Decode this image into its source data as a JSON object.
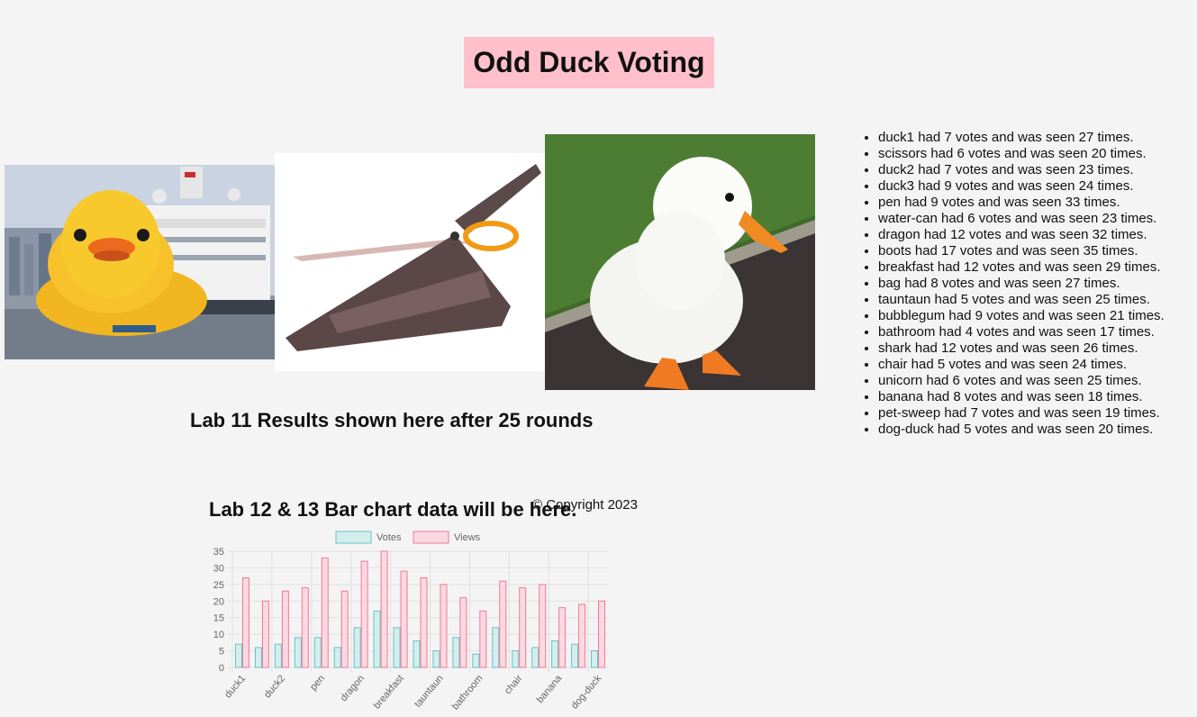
{
  "page": {
    "title": "Odd Duck Voting",
    "lab11_heading": "Lab 11 Results shown here after 25 rounds",
    "lab12_heading": "Lab 12 & 13 Bar chart data will be here.",
    "copyright": "© Copyright 2023"
  },
  "colors": {
    "title_bg": "#ffc0cb",
    "page_bg": "#f4f4f4",
    "votes_fill": "#d3eeee",
    "votes_stroke": "#6cc0c0",
    "views_fill": "#fbd9e0",
    "views_stroke": "#f07a96"
  },
  "images": [
    {
      "name": "duck1",
      "subject": "giant rubber duck next to ship"
    },
    {
      "name": "scissors",
      "subject": "pizza scissors"
    },
    {
      "name": "duck3",
      "subject": "white duck on grass"
    }
  ],
  "results": [
    "duck1 had 7 votes and was seen 27 times.",
    "scissors had 6 votes and was seen 20 times.",
    "duck2 had 7 votes and was seen 23 times.",
    "duck3 had 9 votes and was seen 24 times.",
    "pen had 9 votes and was seen 33 times.",
    "water-can had 6 votes and was seen 23 times.",
    "dragon had 12 votes and was seen 32 times.",
    "boots had 17 votes and was seen 35 times.",
    "breakfast had 12 votes and was seen 29 times.",
    "bag had 8 votes and was seen 27 times.",
    "tauntaun had 5 votes and was seen 25 times.",
    "bubblegum had 9 votes and was seen 21 times.",
    "bathroom had 4 votes and was seen 17 times.",
    "shark had 12 votes and was seen 26 times.",
    "chair had 5 votes and was seen 24 times.",
    "unicorn had 6 votes and was seen 25 times.",
    "banana had 8 votes and was seen 18 times.",
    "pet-sweep had 7 votes and was seen 19 times.",
    "dog-duck had 5 votes and was seen 20 times."
  ],
  "chart_data": {
    "type": "bar",
    "categories": [
      "duck1",
      "scissors",
      "duck2",
      "duck3",
      "pen",
      "water-can",
      "dragon",
      "boots",
      "breakfast",
      "bag",
      "tauntaun",
      "bubblegum",
      "bathroom",
      "shark",
      "chair",
      "unicorn",
      "banana",
      "pet-sweep",
      "dog-duck"
    ],
    "visible_tick_labels": [
      "duck1",
      "duck2",
      "pen",
      "dragon",
      "breakfast",
      "tauntaun",
      "bathroom",
      "chair",
      "banana",
      "dog-duck"
    ],
    "series": [
      {
        "name": "Votes",
        "values": [
          7,
          6,
          7,
          9,
          9,
          6,
          12,
          17,
          12,
          8,
          5,
          9,
          4,
          12,
          5,
          6,
          8,
          7,
          5
        ]
      },
      {
        "name": "Views",
        "values": [
          27,
          20,
          23,
          24,
          33,
          23,
          32,
          35,
          29,
          27,
          25,
          21,
          17,
          26,
          24,
          25,
          18,
          19,
          20
        ]
      }
    ],
    "y_ticks": [
      0,
      5,
      10,
      15,
      20,
      25,
      30,
      35
    ],
    "ylim": [
      0,
      35
    ],
    "grid": true,
    "legend": "top"
  }
}
